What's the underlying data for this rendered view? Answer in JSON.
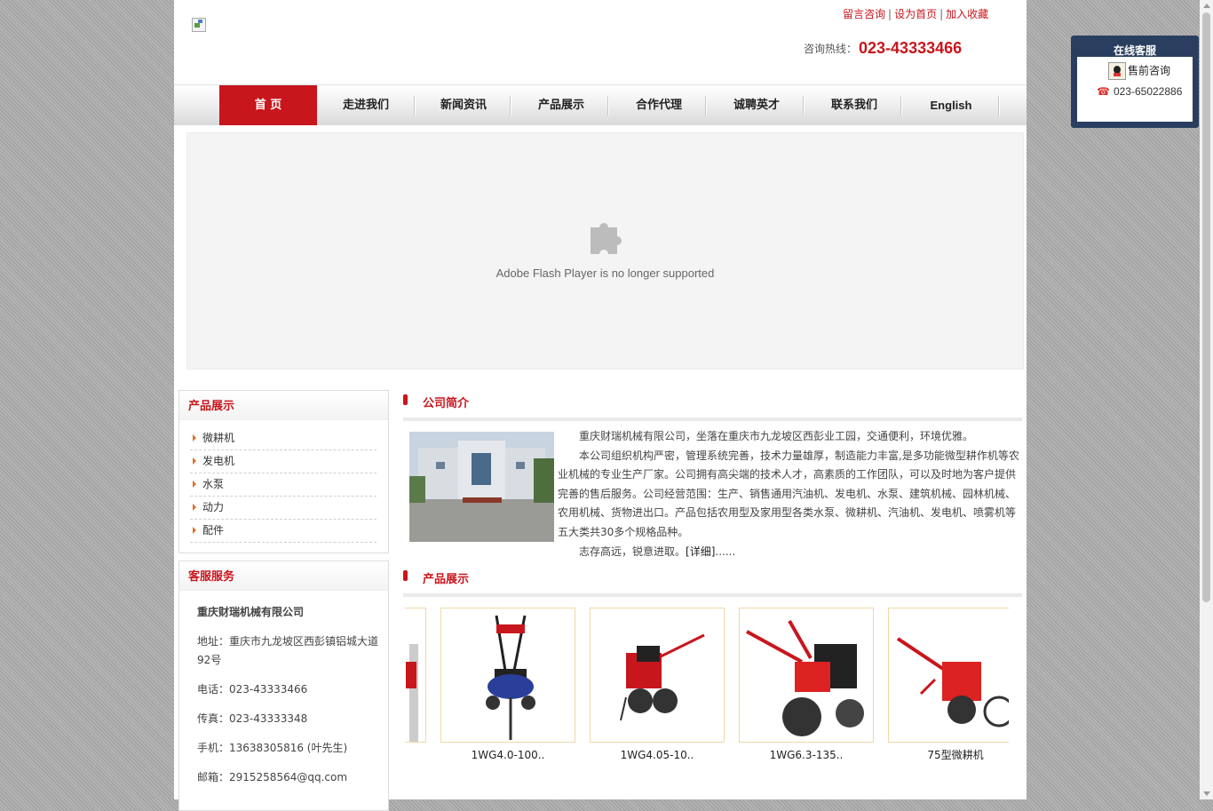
{
  "header": {
    "links": [
      "留言咨询",
      "设为首页",
      "加入收藏"
    ],
    "link_sep": "|",
    "hotline_label": "咨询热线：",
    "hotline_number": "023-43333466"
  },
  "nav": {
    "items": [
      "首 页",
      "走进我们",
      "新闻资讯",
      "产品展示",
      "合作代理",
      "诚聘英才",
      "联系我们",
      "English"
    ],
    "active_index": 0
  },
  "banner": {
    "message": "Adobe Flash Player is no longer supported"
  },
  "sidebar": {
    "products_title": "产品展示",
    "categories": [
      "微耕机",
      "发电机",
      "水泵",
      "动力",
      "配件"
    ],
    "service_title": "客服服务",
    "company": "重庆财瑞机械有限公司",
    "address": "地址：重庆市九龙坡区西彭镇铝城大道92号",
    "phone": "电话：023-43333466",
    "fax": "传真：023-43333348",
    "mobile": "手机：13638305816 (叶先生)",
    "email": "邮箱：2915258564@qq.com"
  },
  "about": {
    "title": "公司简介",
    "p1": "重庆财瑞机械有限公司，坐落在重庆市九龙坡区西彭业工园，交通便利，环境优雅。",
    "p2": "本公司组织机构严密，管理系统完善，技术力量雄厚，制造能力丰富,是多功能微型耕作机等农业机械的专业生产厂家。公司拥有高尖端的技术人才，高素质的工作团队，可以及时地为客户提供完善的售后服务。公司经营范围：生产、销售通用汽油机、发电机、水泵、建筑机械、园林机械、农用机械、货物进出口。产品包括农用型及家用型各类水泵、微耕机、汽油机、发电机、喷雾机等五大类共30多个规格品种。",
    "p3": "志存高远，锐意进取。",
    "more": "[详细]",
    "ellipsis": "......"
  },
  "products": {
    "title": "产品展示",
    "items": [
      "1WG4.0-100..",
      "1WG4.05-10..",
      "1WG6.3-135..",
      "75型微耕机"
    ]
  },
  "kefu": {
    "title": "在线客服",
    "qq_label": "售前咨询",
    "phone": "023-65022886"
  },
  "colors": {
    "accent": "#c8161d",
    "panel": "#2a3f5f"
  }
}
